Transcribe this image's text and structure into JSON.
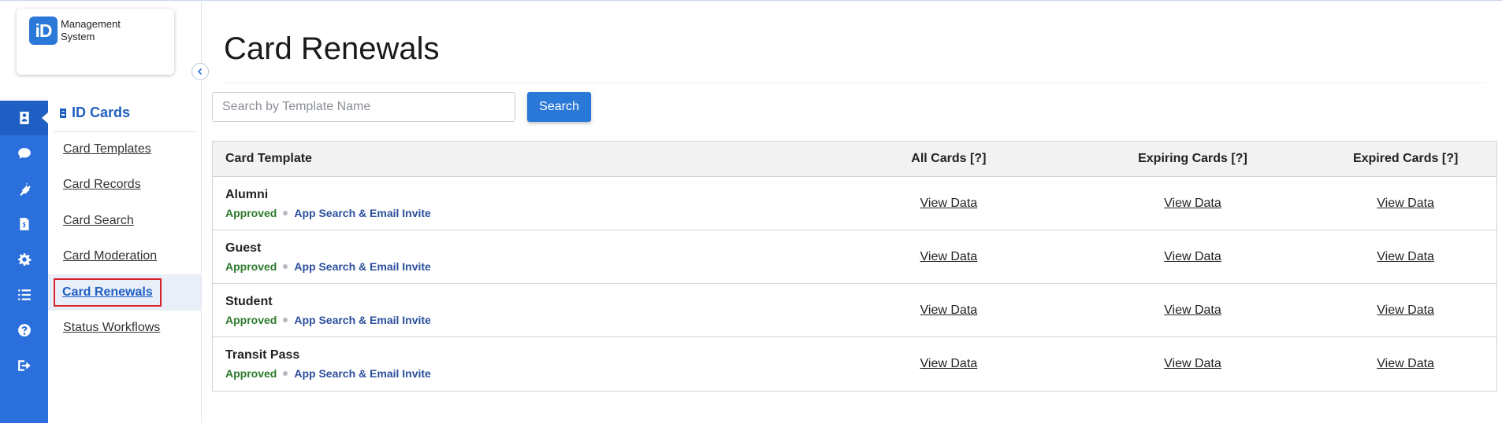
{
  "app": {
    "logo_mark": "iD",
    "logo_line1": "Management",
    "logo_line2": "System"
  },
  "rail": {
    "icons": [
      "id-card-icon",
      "chat-icon",
      "plug-icon",
      "invoice-icon",
      "gear-icon",
      "list-icon",
      "help-icon",
      "logout-icon"
    ],
    "active_index": 0,
    "color": "#2a6fdb"
  },
  "sidebar": {
    "section_title": "ID Cards",
    "items": [
      {
        "label": "Card Templates"
      },
      {
        "label": "Card Records"
      },
      {
        "label": "Card Search"
      },
      {
        "label": "Card Moderation"
      },
      {
        "label": "Card Renewals"
      },
      {
        "label": "Status Workflows"
      }
    ],
    "active_item": "Card Renewals"
  },
  "main": {
    "page_title": "Card Renewals",
    "search": {
      "placeholder": "Search by Template Name",
      "value": "",
      "button_label": "Search"
    },
    "table": {
      "headers": [
        "Card Template",
        "All Cards [?]",
        "Expiring Cards [?]",
        "Expired Cards [?]"
      ],
      "rows": [
        {
          "name": "Alumni",
          "status": "Approved",
          "access": "App Search & Email Invite",
          "all": "View Data",
          "expiring": "View Data",
          "expired": "View Data"
        },
        {
          "name": "Guest",
          "status": "Approved",
          "access": "App Search & Email Invite",
          "all": "View Data",
          "expiring": "View Data",
          "expired": "View Data"
        },
        {
          "name": "Student",
          "status": "Approved",
          "access": "App Search & Email Invite",
          "all": "View Data",
          "expiring": "View Data",
          "expired": "View Data"
        },
        {
          "name": "Transit Pass",
          "status": "Approved",
          "access": "App Search & Email Invite",
          "all": "View Data",
          "expiring": "View Data",
          "expired": "View Data"
        }
      ]
    }
  },
  "colors": {
    "accent": "#2a78d8",
    "status_approved": "#2c7a2c",
    "access_text": "#2a4f9c",
    "highlight_box": "#d6222a"
  }
}
